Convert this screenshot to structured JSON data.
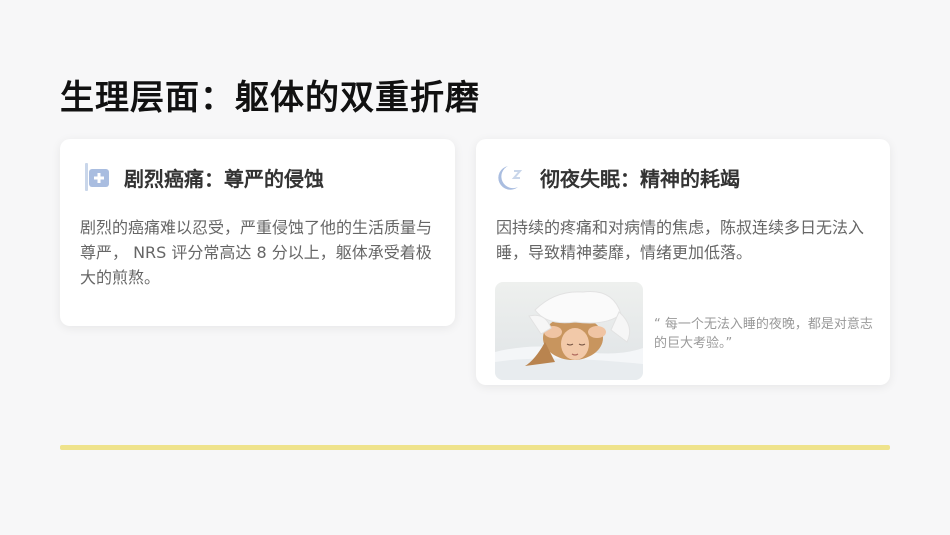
{
  "page": {
    "title": "生理层面：躯体的双重折磨"
  },
  "cards": [
    {
      "icon": "medical-cross-icon",
      "title": "剧烈癌痛：尊严的侵蚀",
      "body": "剧烈的癌痛难以忍受，严重侵蚀了他的生活质量与尊严， NRS 评分常高达 8 分以上，躯体承受着极大的煎熬。"
    },
    {
      "icon": "moon-sleep-icon",
      "title": "彻夜失眠：精神的耗竭",
      "body": "因持续的疼痛和对病情的焦虑，陈叔连续多日无法入睡，导致精神萎靡，情绪更加低落。",
      "image": "woman-covering-ears-with-pillow",
      "quote": "“ 每一个无法入睡的夜晚，都是对意志的巨大考验。”"
    }
  ],
  "colors": {
    "accent": "#efe38c",
    "icon_blue": "#9fb6d8",
    "title": "#111111",
    "body_text": "#666666"
  }
}
